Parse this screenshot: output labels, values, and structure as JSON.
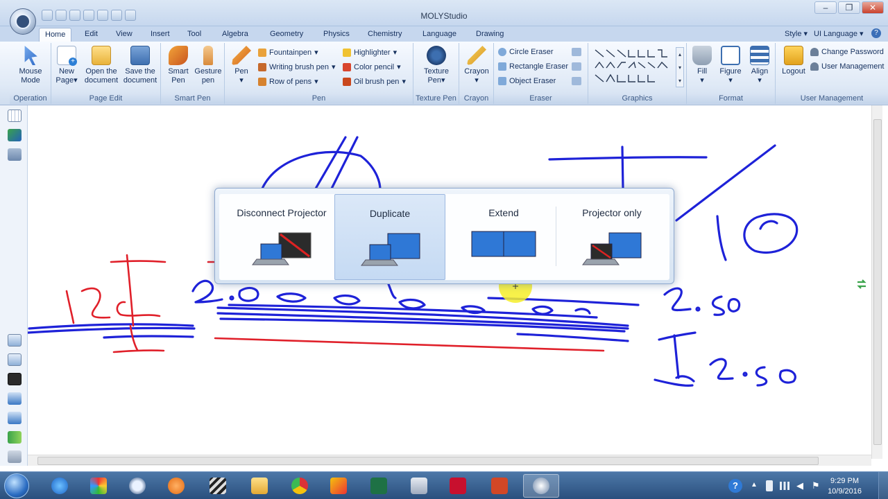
{
  "window": {
    "title": "MOLYStudio"
  },
  "tabs": [
    "Home",
    "Edit",
    "View",
    "Insert",
    "Tool",
    "Algebra",
    "Geometry",
    "Physics",
    "Chemistry",
    "Language",
    "Drawing"
  ],
  "right_menu": {
    "style": "Style",
    "ui_language": "UI Language"
  },
  "ribbon": {
    "operation": {
      "label": "Operation",
      "mouse_mode_1": "Mouse",
      "mouse_mode_2": "Mode"
    },
    "page_edit": {
      "label": "Page Edit",
      "new_page_1": "New",
      "new_page_2": "Page",
      "open_1": "Open the",
      "open_2": "document",
      "save_1": "Save the",
      "save_2": "document"
    },
    "smart_pen": {
      "label": "Smart Pen",
      "smart_1": "Smart",
      "smart_2": "Pen",
      "gesture_1": "Gesture",
      "gesture_2": "pen"
    },
    "pen": {
      "label": "Pen",
      "pen": "Pen",
      "fountainpen": "Fountainpen",
      "writing_brush_pen": "Writing brush pen",
      "row_of_pens": "Row of pens",
      "highlighter": "Highlighter",
      "color_pencil": "Color pencil",
      "oil_brush_pen": "Oil brush pen"
    },
    "texture_pen": {
      "label": "Texture Pen",
      "texture_1": "Texture",
      "texture_2": "Pen"
    },
    "crayon": {
      "label": "Crayon",
      "crayon": "Crayon"
    },
    "eraser": {
      "label": "Eraser",
      "circle": "Circle Eraser",
      "rectangle": "Rectangle Eraser",
      "object": "Object Eraser"
    },
    "graphics": {
      "label": "Graphics"
    },
    "format": {
      "label": "Format",
      "fill": "Fill",
      "figure": "Figure",
      "align": "Align"
    },
    "user_management": {
      "label": "User Management",
      "logout": "Logout",
      "change_password": "Change Password",
      "user_management": "User Management"
    }
  },
  "projector_dialog": {
    "options": [
      {
        "label": "Disconnect Projector",
        "selected": false
      },
      {
        "label": "Duplicate",
        "selected": true
      },
      {
        "label": "Extend",
        "selected": false
      },
      {
        "label": "Projector only",
        "selected": false
      }
    ]
  },
  "clock": {
    "time": "9:29 PM",
    "date": "10/9/2016"
  },
  "colors": {
    "ink_blue": "#1e22d8",
    "ink_red": "#e0202a",
    "ribbon_bg": "#dfe9f6",
    "taskbar": "#2a4f7d",
    "selected": "#c5daf3"
  }
}
